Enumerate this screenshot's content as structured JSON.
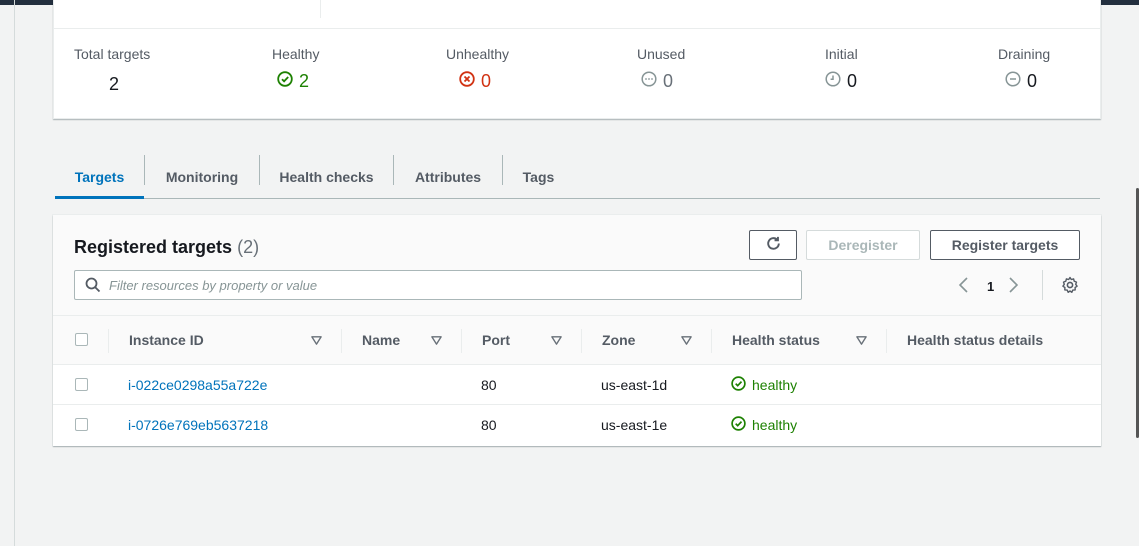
{
  "summary": {
    "stats": [
      {
        "label": "Total targets",
        "value": "2",
        "icon": "",
        "color": "#16191f"
      },
      {
        "label": "Healthy",
        "value": "2",
        "icon": "check-circle-icon",
        "color": "#1d8102"
      },
      {
        "label": "Unhealthy",
        "value": "0",
        "icon": "x-circle-icon",
        "color": "#d13212"
      },
      {
        "label": "Unused",
        "value": "0",
        "icon": "ellipsis-circle-icon",
        "color": "#687078"
      },
      {
        "label": "Initial",
        "value": "0",
        "icon": "clock-icon",
        "color": "#16191f"
      },
      {
        "label": "Draining",
        "value": "0",
        "icon": "minus-circle-icon",
        "color": "#16191f"
      }
    ]
  },
  "tabs": [
    {
      "label": "Targets",
      "active": true
    },
    {
      "label": "Monitoring",
      "active": false
    },
    {
      "label": "Health checks",
      "active": false
    },
    {
      "label": "Attributes",
      "active": false
    },
    {
      "label": "Tags",
      "active": false
    }
  ],
  "panel": {
    "title": "Registered targets",
    "count": "(2)",
    "refresh_icon": "refresh-icon",
    "deregister_label": "Deregister",
    "register_label": "Register targets",
    "search_placeholder": "Filter resources by property or value",
    "page": "1"
  },
  "table": {
    "headers": [
      "Instance ID",
      "Name",
      "Port",
      "Zone",
      "Health status",
      "Health status details"
    ],
    "rows": [
      {
        "instance_id": "i-022ce0298a55a722e",
        "name": "",
        "port": "80",
        "zone": "us-east-1d",
        "health_status": "healthy",
        "details": ""
      },
      {
        "instance_id": "i-0726e769eb5637218",
        "name": "",
        "port": "80",
        "zone": "us-east-1e",
        "health_status": "healthy",
        "details": ""
      }
    ]
  },
  "colors": {
    "accent": "#0073bb",
    "healthy": "#1d8102",
    "unhealthy": "#d13212"
  }
}
